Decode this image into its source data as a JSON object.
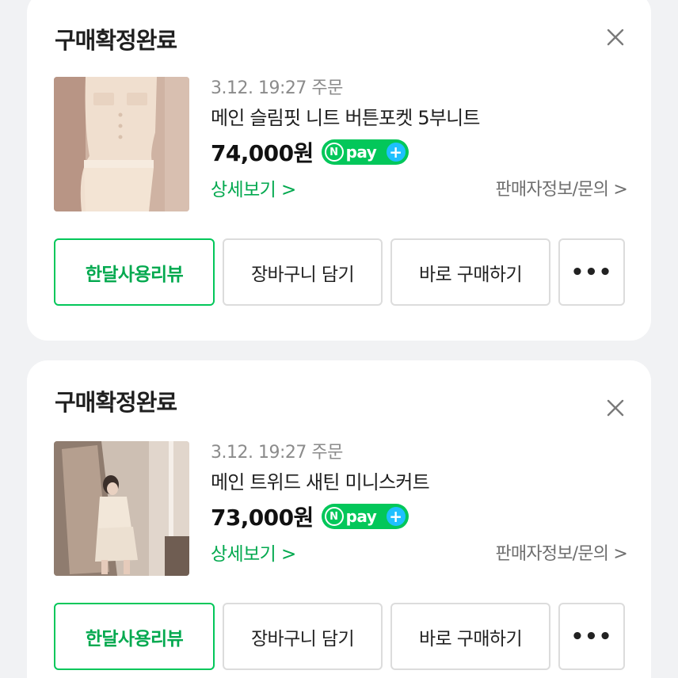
{
  "orders": [
    {
      "status": "구매확정완료",
      "date": "3.12. 19:27 주문",
      "product_name": "메인 슬림핏 니트 버튼포켓 5부니트",
      "price": "74,000원",
      "npay": {
        "n": "N",
        "text": "pay",
        "plus": "+"
      },
      "detail_link": "상세보기 >",
      "seller_link": "판매자정보/문의 >",
      "actions": {
        "review": "한달사용리뷰",
        "cart": "장바구니 담기",
        "buy": "바로 구매하기",
        "more": "•••"
      },
      "thumbnail_icon": "knit-dress-photo"
    },
    {
      "status": "구매확정완료",
      "date": "3.12. 19:27 주문",
      "product_name": "메인 트위드 새틴 미니스커트",
      "price": "73,000원",
      "npay": {
        "n": "N",
        "text": "pay",
        "plus": "+"
      },
      "detail_link": "상세보기 >",
      "seller_link": "판매자정보/문의 >",
      "actions": {
        "review": "한달사용리뷰",
        "cart": "장바구니 담기",
        "buy": "바로 구매하기",
        "more": "•••"
      },
      "thumbnail_icon": "mirror-selfie-photo"
    }
  ],
  "colors": {
    "background": "#f1f2f4",
    "card": "#ffffff",
    "naver_green": "#03c75a",
    "link_green": "#03a94f",
    "npay_plus": "#1ec0ff",
    "text_primary": "#1f1f1f",
    "text_muted": "#8b8b8b",
    "border": "#dcdcdc"
  }
}
